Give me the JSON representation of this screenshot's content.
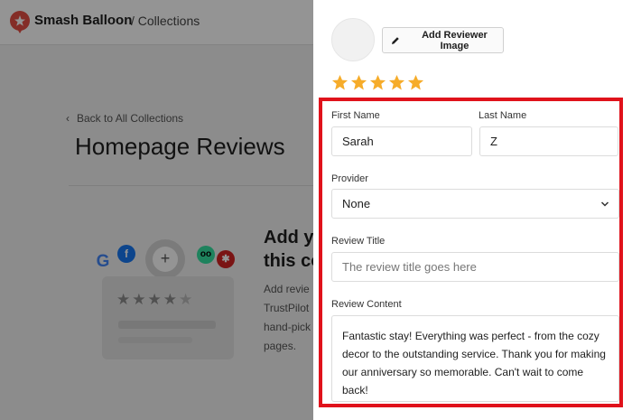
{
  "header": {
    "brand": "Smash Balloon",
    "breadcrumb": "/ Collections"
  },
  "page": {
    "back_link": "Back to All Collections",
    "title": "Homepage Reviews",
    "add_heading_line1": "Add yo",
    "add_heading_line2": "this co",
    "add_desc_lines": [
      "Add revie",
      "TrustPilot",
      "hand-pick",
      "pages."
    ]
  },
  "illustration": {
    "plus": "+",
    "google_letter": "G",
    "facebook_letter": "f",
    "tripadvisor_glyph": "oo",
    "yelp_glyph": "✱"
  },
  "review_form": {
    "add_image_label": "Add Reviewer Image",
    "rating": 5,
    "star_color": "#f6ac2a",
    "first_name_label": "First Name",
    "first_name_value": "Sarah",
    "last_name_label": "Last Name",
    "last_name_value": "Z",
    "provider_label": "Provider",
    "provider_value": "None",
    "review_title_label": "Review Title",
    "review_title_placeholder": "The review title goes here",
    "review_content_label": "Review Content",
    "review_content_value": "Fantastic stay! Everything was perfect - from the cozy decor to the outstanding service. Thank you for making our anniversary so memorable. Can't wait to come back!"
  },
  "colors": {
    "highlight_border": "#e0121b",
    "brand_red": "#e34f44"
  }
}
